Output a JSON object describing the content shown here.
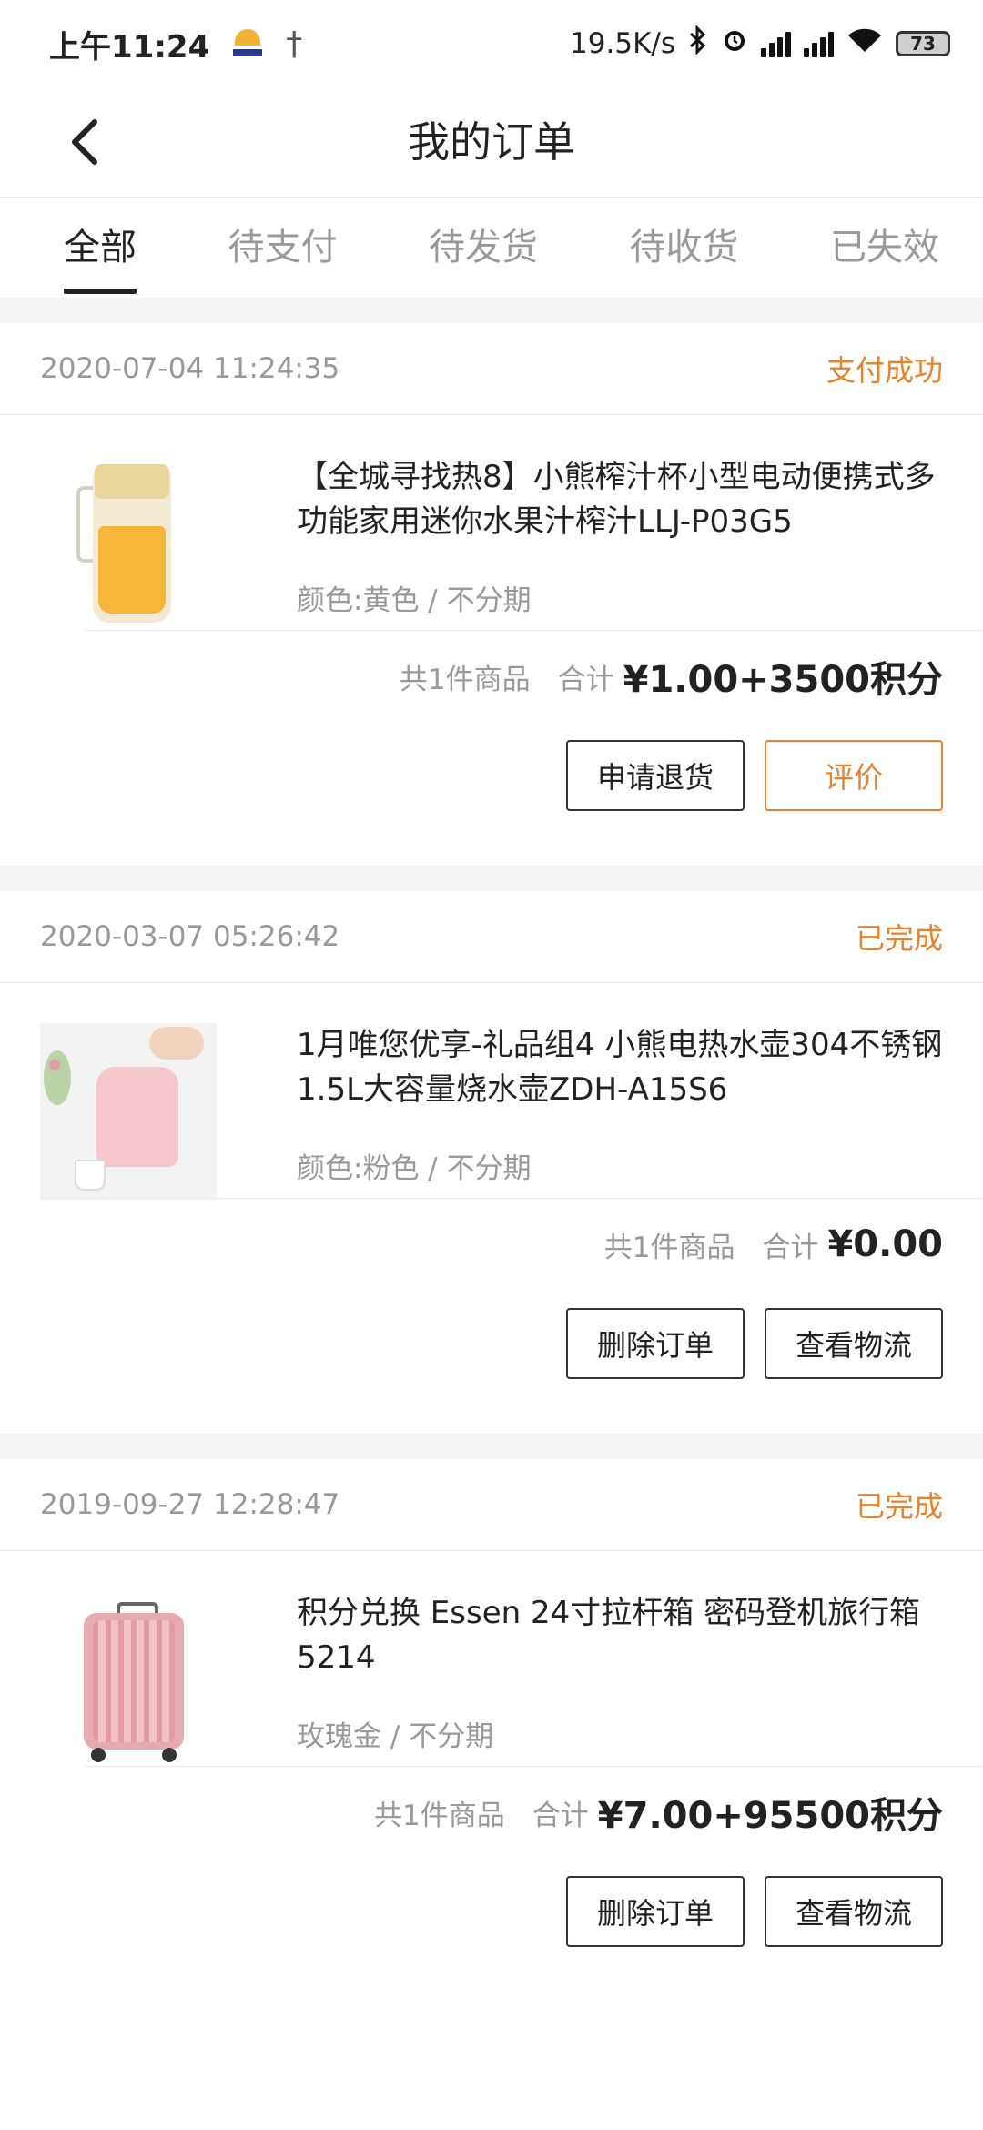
{
  "status_bar": {
    "time": "上午11:24",
    "net_speed": "19.5K/s",
    "battery": "73"
  },
  "nav": {
    "title": "我的订单"
  },
  "tabs": [
    {
      "label": "全部",
      "active": true
    },
    {
      "label": "待支付",
      "active": false
    },
    {
      "label": "待发货",
      "active": false
    },
    {
      "label": "待收货",
      "active": false
    },
    {
      "label": "已失效",
      "active": false
    }
  ],
  "orders": [
    {
      "time": "2020-07-04 11:24:35",
      "status": "支付成功",
      "title": "【全城寻找热8】小熊榨汁杯小型电动便携式多功能家用迷你水果汁榨汁LLJ-P03G5",
      "spec": "颜色:黄色 / 不分期",
      "count": "共1件商品",
      "total_label": "合计",
      "total": "¥1.00+3500积分",
      "buttons": [
        "申请退货",
        "评价"
      ],
      "image": "juicer-cup-yellow"
    },
    {
      "time": "2020-03-07 05:26:42",
      "status": "已完成",
      "title": "1月唯您优享-礼品组4 小熊电热水壶304不锈钢1.5L大容量烧水壶ZDH-A15S6",
      "spec": "颜色:粉色 / 不分期",
      "count": "共1件商品",
      "total_label": "合计",
      "total": "¥0.00",
      "buttons": [
        "删除订单",
        "查看物流"
      ],
      "image": "electric-kettle-pink"
    },
    {
      "time": "2019-09-27 12:28:47",
      "status": "已完成",
      "title": "积分兑换 Essen 24寸拉杆箱 密码登机旅行箱5214",
      "spec": "玫瑰金 / 不分期",
      "count": "共1件商品",
      "total_label": "合计",
      "total": "¥7.00+95500积分",
      "buttons": [
        "删除订单",
        "查看物流"
      ],
      "image": "luggage-rose-gold"
    }
  ],
  "colors": {
    "accent": "#e9822a",
    "text": "#222222",
    "muted": "#999999"
  }
}
